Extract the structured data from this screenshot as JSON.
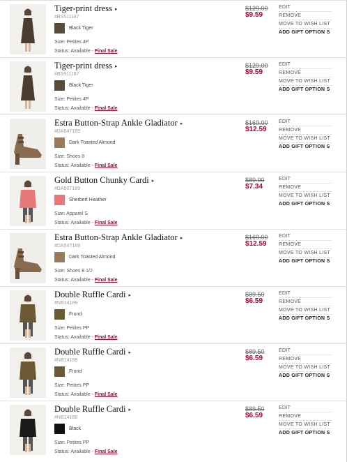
{
  "labels": {
    "size_prefix": "Size: ",
    "status_prefix": "Status: Available - ",
    "final_sale": "Final Sale",
    "arrow": "▸",
    "edit": "EDIT",
    "remove": "REMOVE",
    "move_to_wish_list": "MOVE TO WISH LIST",
    "add_gift_options": "ADD GIFT OPTION S"
  },
  "items": [
    {
      "name": "Tiger-print dress",
      "sku": "#BS511187",
      "color": "Black Tiger",
      "swatch": "#5a4a3a",
      "size": "Petites 4P",
      "old_price": "$129.00",
      "new_price": "$9.59",
      "figure": "dress",
      "fig_color": "#4a3d30"
    },
    {
      "name": "Tiger-print dress",
      "sku": "#BS511187",
      "color": "Black Tiger",
      "swatch": "#5a4a3a",
      "size": "Petites 4P",
      "old_price": "$129.00",
      "new_price": "$9.59",
      "figure": "dress",
      "fig_color": "#4a3d30"
    },
    {
      "name": "Estra Button-Strap Ankle Gladiator",
      "sku": "#DA547189",
      "color": "Dark Toasted Almond",
      "swatch": "#9b7a5c",
      "size": "Shoes 8",
      "old_price": "$169.00",
      "new_price": "$12.59",
      "figure": "shoe",
      "fig_color": "#8a6a4e"
    },
    {
      "name": "Gold Button Chunky Cardi",
      "sku": "#DA507189",
      "color": "Sherbert Heather",
      "swatch": "#e8787a",
      "size": "Apparel S",
      "old_price": "$89.00",
      "new_price": "$7.34",
      "figure": "cardi",
      "fig_color": "#e8787a"
    },
    {
      "name": "Estra Button-Strap Ankle Gladiator",
      "sku": "#DA547189",
      "color": "Dark Toasted Almond",
      "swatch": "#9b7a5c",
      "size": "Shoes 8 1/2",
      "old_price": "$169.00",
      "new_price": "$12.59",
      "figure": "shoe",
      "fig_color": "#8a6a4e"
    },
    {
      "name": "Double Ruffle Cardi",
      "sku": "#NB14189",
      "color": "Frond",
      "swatch": "#6b5a34",
      "size": "Petites PP",
      "old_price": "$89.50",
      "new_price": "$6.59",
      "figure": "cardi",
      "fig_color": "#6b5a34"
    },
    {
      "name": "Double Ruffle Cardi",
      "sku": "#NB14189",
      "color": "Frond",
      "swatch": "#6b5a34",
      "size": "Petites PP",
      "old_price": "$89.50",
      "new_price": "$6.59",
      "figure": "cardi",
      "fig_color": "#6b5a34"
    },
    {
      "name": "Double Ruffle Cardi",
      "sku": "#NB14189",
      "color": "Black",
      "swatch": "#111111",
      "size": "Petites PP",
      "old_price": "$89.50",
      "new_price": "$6.59",
      "figure": "cardi",
      "fig_color": "#1a1a1a"
    }
  ]
}
